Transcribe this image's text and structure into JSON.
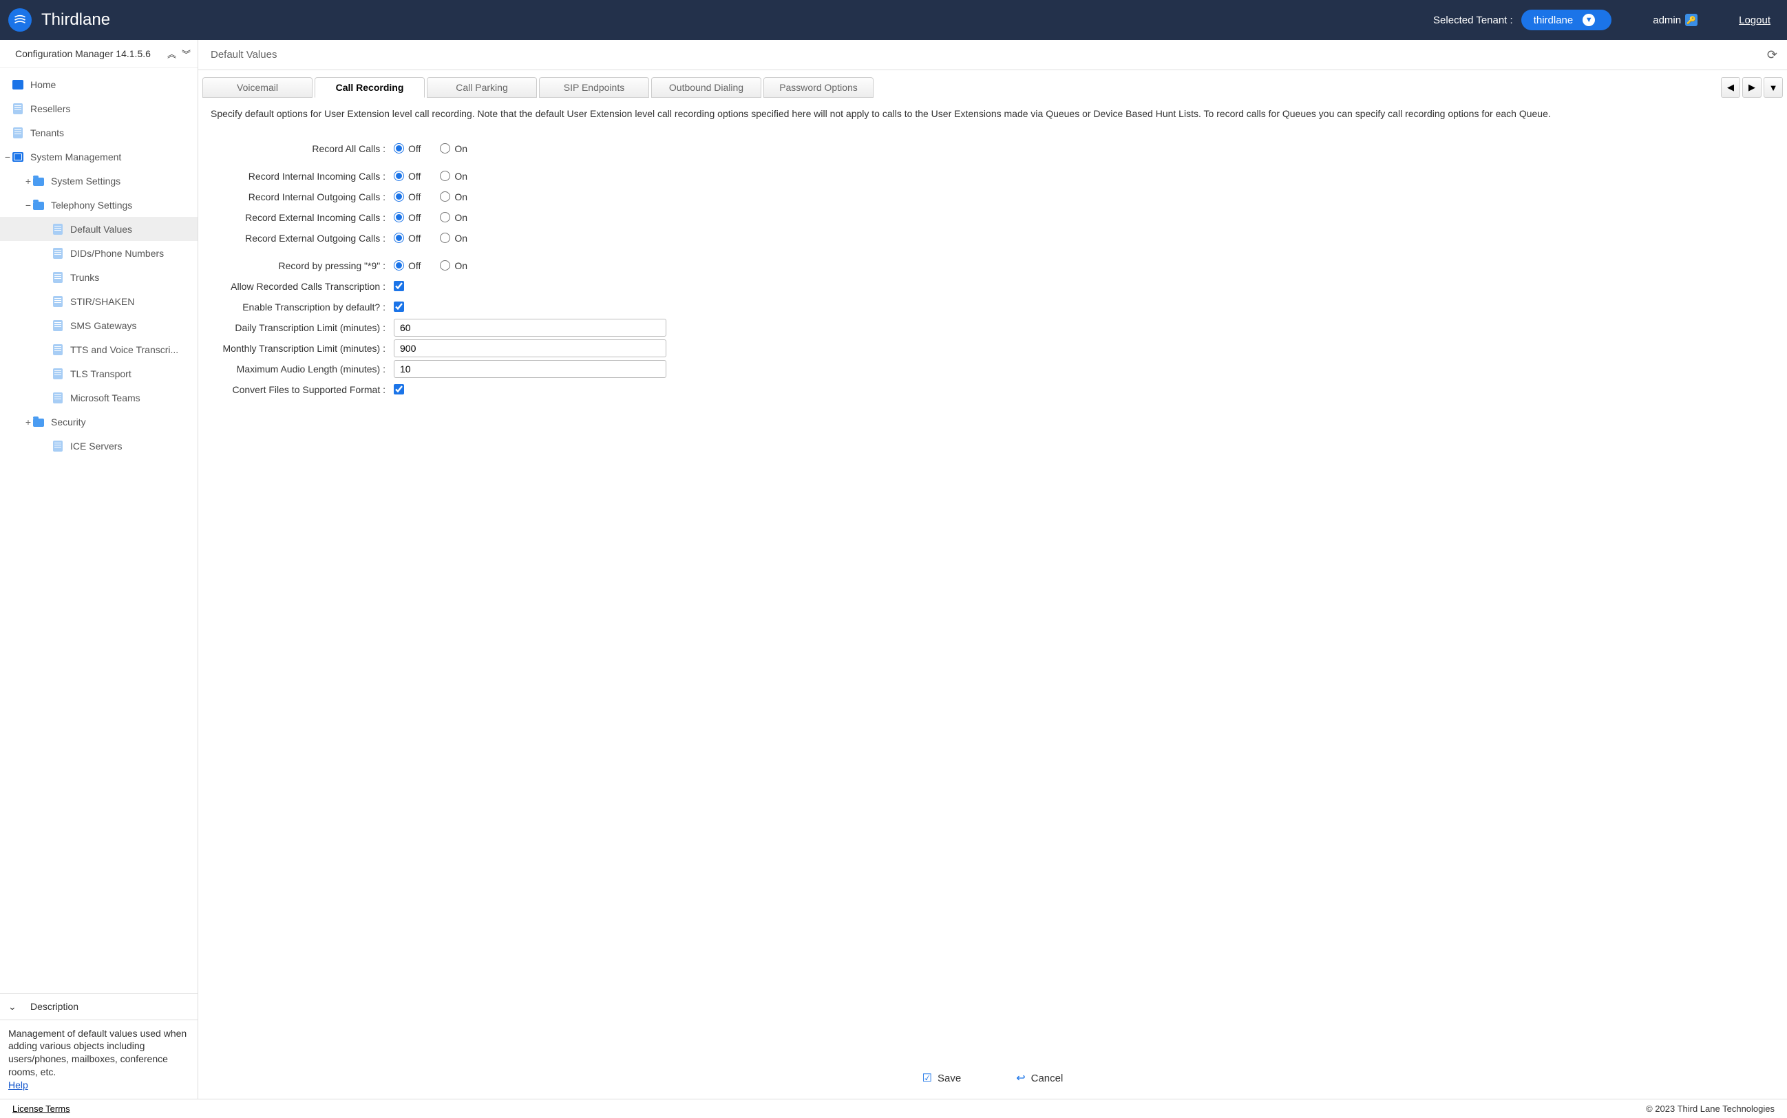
{
  "topbar": {
    "brand": "Thirdlane",
    "tenant_label": "Selected Tenant :",
    "tenant_value": "thirdlane",
    "user": "admin",
    "logout": "Logout"
  },
  "sidebar": {
    "title": "Configuration Manager 14.1.5.6",
    "items": [
      {
        "label": "Home",
        "level": 1,
        "icon": "home"
      },
      {
        "label": "Resellers",
        "level": 1,
        "icon": "file"
      },
      {
        "label": "Tenants",
        "level": 1,
        "icon": "file"
      },
      {
        "label": "System Management",
        "level": 1,
        "icon": "sys",
        "exp": "−"
      },
      {
        "label": "System Settings",
        "level": 2,
        "icon": "folder",
        "exp": "+"
      },
      {
        "label": "Telephony Settings",
        "level": 2,
        "icon": "folder",
        "exp": "−"
      },
      {
        "label": "Default Values",
        "level": 3,
        "icon": "file",
        "active": true
      },
      {
        "label": "DIDs/Phone Numbers",
        "level": 3,
        "icon": "file"
      },
      {
        "label": "Trunks",
        "level": 3,
        "icon": "file"
      },
      {
        "label": "STIR/SHAKEN",
        "level": 3,
        "icon": "file"
      },
      {
        "label": "SMS Gateways",
        "level": 3,
        "icon": "file"
      },
      {
        "label": "TTS and Voice Transcri...",
        "level": 3,
        "icon": "file"
      },
      {
        "label": "TLS Transport",
        "level": 3,
        "icon": "file"
      },
      {
        "label": "Microsoft Teams",
        "level": 3,
        "icon": "file"
      },
      {
        "label": "Security",
        "level": 2,
        "icon": "folder",
        "exp": "+"
      },
      {
        "label": "ICE Servers",
        "level": 3,
        "icon": "file"
      }
    ],
    "description_title": "Description",
    "description_body": "Management of default values used when adding various objects including users/phones, mailboxes, conference rooms, etc.",
    "help_link": "Help"
  },
  "content": {
    "page_title": "Default Values",
    "tabs": [
      "Voicemail",
      "Call Recording",
      "Call Parking",
      "SIP Endpoints",
      "Outbound Dialing",
      "Password Options"
    ],
    "active_tab": 1,
    "panel_desc": "Specify default options for User Extension level call recording. Note that the default User Extension level call recording options specified here will not apply to calls to the User Extensions made via Queues or Device Based Hunt Lists. To record calls for Queues you can specify call recording options for each Queue.",
    "fields": {
      "record_all": {
        "label": "Record All Calls :",
        "value": "Off"
      },
      "rec_int_in": {
        "label": "Record Internal Incoming Calls :",
        "value": "Off"
      },
      "rec_int_out": {
        "label": "Record Internal Outgoing Calls :",
        "value": "Off"
      },
      "rec_ext_in": {
        "label": "Record External Incoming Calls :",
        "value": "Off"
      },
      "rec_ext_out": {
        "label": "Record External Outgoing Calls :",
        "value": "Off"
      },
      "record_star9": {
        "label": "Record by pressing \"*9\"  :",
        "value": "Off"
      },
      "allow_trans": {
        "label": "Allow Recorded Calls Transcription :",
        "checked": true
      },
      "enable_trans": {
        "label": "Enable Transcription by default?  :",
        "checked": true
      },
      "daily_limit": {
        "label": "Daily Transcription Limit (minutes) :",
        "value": "60"
      },
      "monthly_limit": {
        "label": "Monthly Transcription Limit (minutes) :",
        "value": "900"
      },
      "max_audio": {
        "label": "Maximum Audio Length (minutes) :",
        "value": "10"
      },
      "convert": {
        "label": "Convert Files to Supported Format :",
        "checked": true
      }
    },
    "radio_off": "Off",
    "radio_on": "On",
    "save": "Save",
    "cancel": "Cancel"
  },
  "footer": {
    "license": "License Terms",
    "copyright": "© 2023 Third Lane Technologies"
  }
}
